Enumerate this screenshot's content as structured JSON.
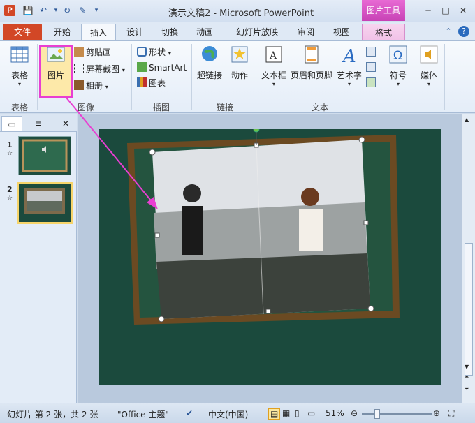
{
  "window": {
    "title": "演示文稿2 - Microsoft PowerPoint",
    "contextual_tab_group": "图片工具",
    "controls": [
      "─",
      "□",
      "✕"
    ]
  },
  "quick_access": [
    "save-icon",
    "undo-icon",
    "redo-icon",
    "format-painter-icon"
  ],
  "tabs": [
    {
      "label": "文件"
    },
    {
      "label": "开始"
    },
    {
      "label": "插入"
    },
    {
      "label": "设计"
    },
    {
      "label": "切换"
    },
    {
      "label": "动画"
    },
    {
      "label": "幻灯片放映"
    },
    {
      "label": "审阅"
    },
    {
      "label": "视图"
    },
    {
      "label": "格式"
    }
  ],
  "ribbon": {
    "groups": {
      "tables": {
        "label": "表格",
        "button": "表格"
      },
      "images": {
        "label": "图像",
        "picture": "图片",
        "clipart": "剪贴画",
        "screenshot": "屏幕截图",
        "album": "相册"
      },
      "illustrations": {
        "label": "插图",
        "shapes": "形状",
        "smartart": "SmartArt",
        "chart": "图表"
      },
      "links": {
        "label": "链接",
        "hyperlink": "超链接",
        "action": "动作"
      },
      "text": {
        "label": "文本",
        "textbox": "文本框",
        "header_footer": "页眉和页脚",
        "wordart": "艺术字"
      },
      "symbols": {
        "label": "符号"
      },
      "media": {
        "label": "媒体"
      }
    }
  },
  "slides_pane": {
    "slides": [
      {
        "num": "1"
      },
      {
        "num": "2"
      }
    ]
  },
  "status": {
    "slide_info": "幻灯片 第 2 张，共 2 张",
    "theme": "\"Office 主题\"",
    "language": "中文(中国)",
    "zoom": "51%"
  },
  "colors": {
    "accent_pink": "#e83fd2",
    "file_tab": "#d24726",
    "slide_bg": "#1b4a3d"
  }
}
